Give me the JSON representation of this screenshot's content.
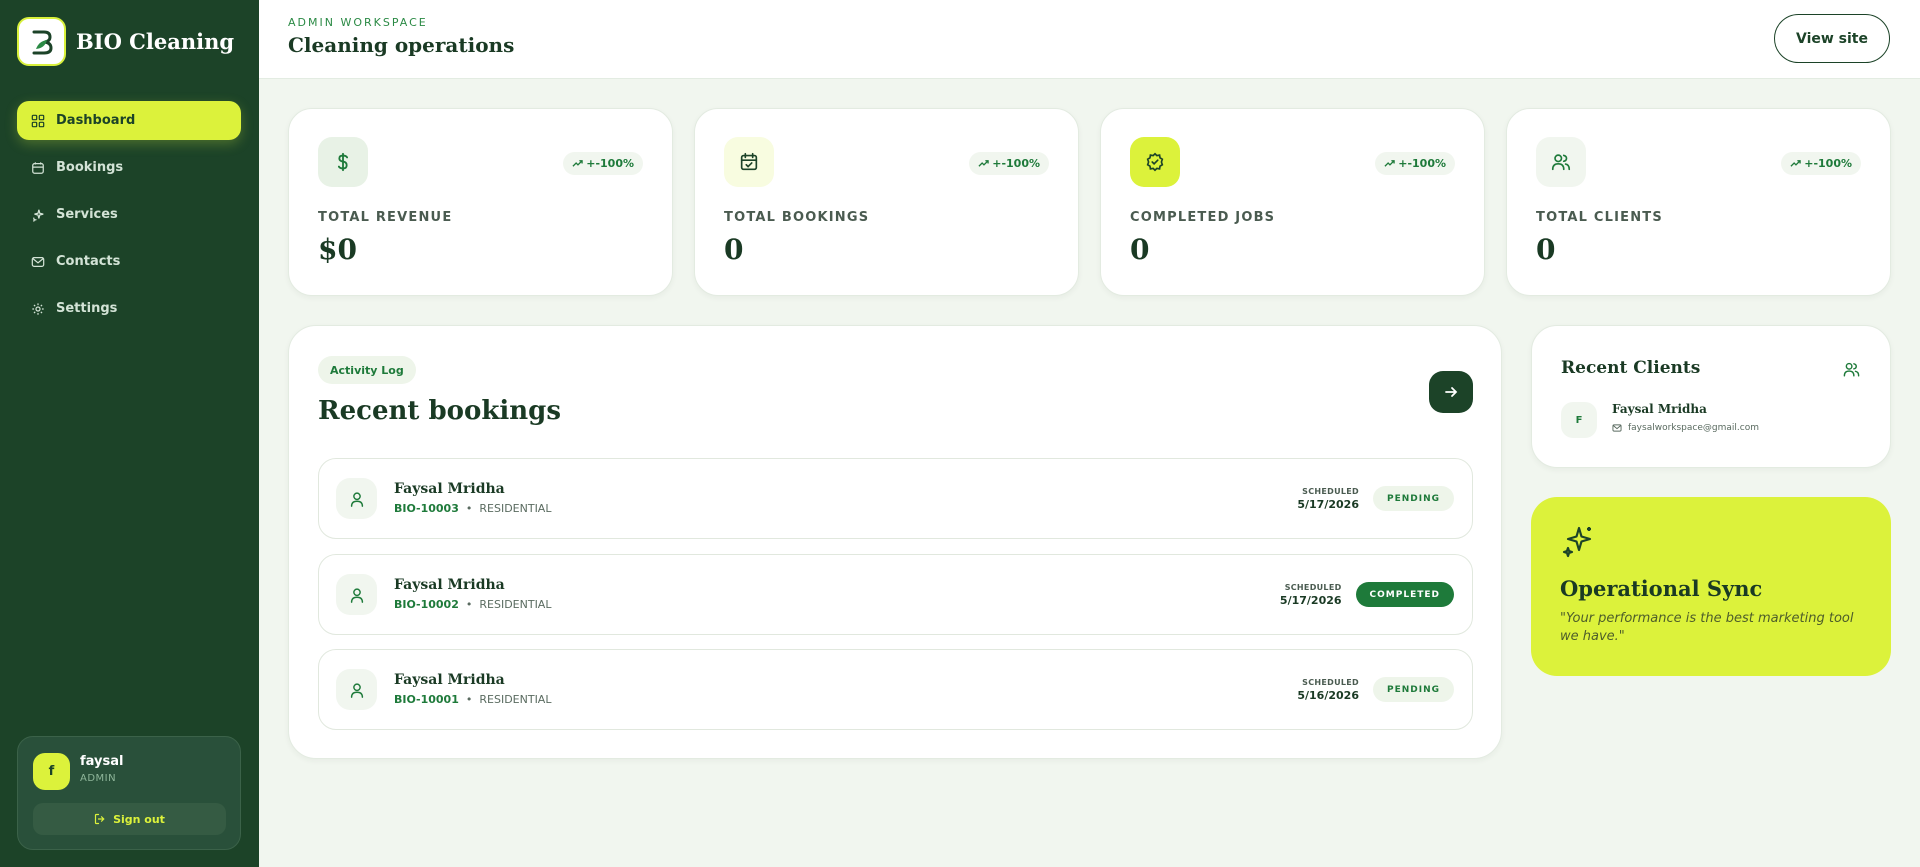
{
  "brand": {
    "name": "BIO Cleaning",
    "logo_letter": "B"
  },
  "sidebar": {
    "items": [
      {
        "label": "Dashboard",
        "icon": "grid-icon",
        "active": true
      },
      {
        "label": "Bookings",
        "icon": "calendar-icon"
      },
      {
        "label": "Services",
        "icon": "sparkle-icon"
      },
      {
        "label": "Contacts",
        "icon": "mail-icon"
      },
      {
        "label": "Settings",
        "icon": "gear-icon"
      }
    ],
    "user": {
      "initial": "f",
      "name": "faysal",
      "role": "ADMIN",
      "signout_label": "Sign out"
    }
  },
  "header": {
    "eyebrow": "ADMIN WORKSPACE",
    "title": "Cleaning operations",
    "view_site_label": "View site"
  },
  "stats": [
    {
      "label": "TOTAL REVENUE",
      "value": "$0",
      "trend": "+-100%",
      "icon": "dollar-icon"
    },
    {
      "label": "TOTAL BOOKINGS",
      "value": "0",
      "trend": "+-100%",
      "icon": "calendar-check-icon"
    },
    {
      "label": "COMPLETED JOBS",
      "value": "0",
      "trend": "+-100%",
      "icon": "badge-check-icon"
    },
    {
      "label": "TOTAL CLIENTS",
      "value": "0",
      "trend": "+-100%",
      "icon": "users-icon"
    }
  ],
  "bookings": {
    "chip": "Activity Log",
    "title": "Recent bookings",
    "rows": [
      {
        "name": "Faysal Mridha",
        "id": "BIO-10003",
        "type": "RESIDENTIAL",
        "sched_label": "SCHEDULED",
        "date": "5/17/2026",
        "status": "PENDING"
      },
      {
        "name": "Faysal Mridha",
        "id": "BIO-10002",
        "type": "RESIDENTIAL",
        "sched_label": "SCHEDULED",
        "date": "5/17/2026",
        "status": "COMPLETED"
      },
      {
        "name": "Faysal Mridha",
        "id": "BIO-10001",
        "type": "RESIDENTIAL",
        "sched_label": "SCHEDULED",
        "date": "5/16/2026",
        "status": "PENDING"
      }
    ]
  },
  "clients": {
    "title": "Recent Clients",
    "items": [
      {
        "initial": "F",
        "name": "Faysal Mridha",
        "email": "faysalworkspace@gmail.com"
      }
    ]
  },
  "sync": {
    "title": "Operational Sync",
    "quote": "\"Your performance is the best marketing tool we have.\""
  },
  "colors": {
    "sidebar": "#1c4328",
    "accent": "#dcf23b",
    "primary_green": "#1e7a3a",
    "background": "#f1f6ef"
  }
}
